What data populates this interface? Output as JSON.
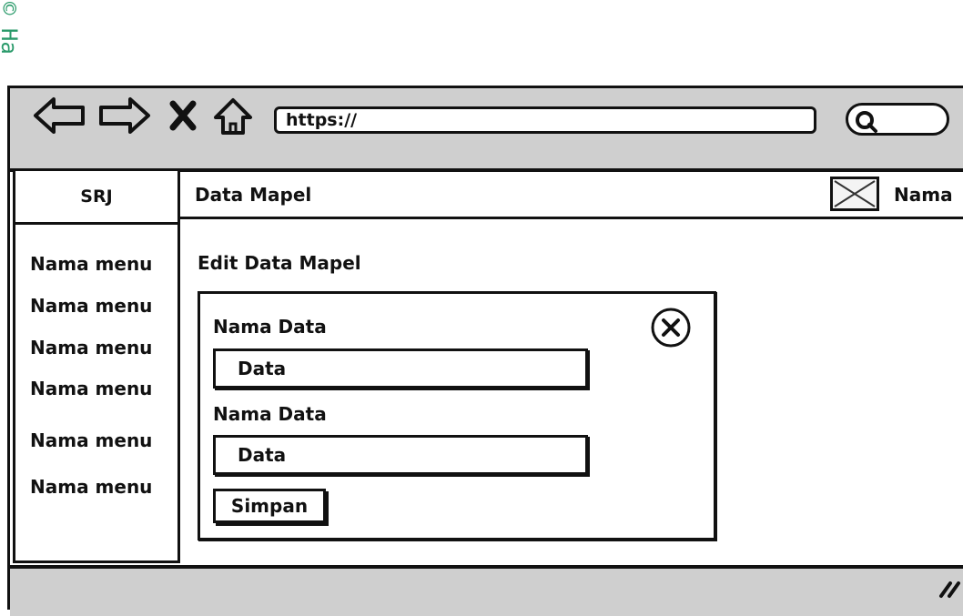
{
  "watermark": "© Ha",
  "browser": {
    "url": "https://",
    "nav": [
      "back-icon",
      "forward-icon",
      "stop-icon",
      "home-icon"
    ],
    "search_icon": "search-icon"
  },
  "sidebar": {
    "brand": "SRJ",
    "items": [
      {
        "label": "Nama menu"
      },
      {
        "label": "Nama menu"
      },
      {
        "label": "Nama menu"
      },
      {
        "label": "Nama menu"
      },
      {
        "label": "Nama menu"
      },
      {
        "label": "Nama menu"
      }
    ]
  },
  "header": {
    "title": "Data Mapel",
    "avatar_icon": "image-placeholder-icon",
    "user_name": "Nama"
  },
  "main": {
    "title": "Edit Data Mapel",
    "modal": {
      "fields": [
        {
          "label": "Nama Data",
          "value": "Data"
        },
        {
          "label": "Nama Data",
          "value": "Data"
        }
      ],
      "submit_label": "Simpan",
      "close_icon": "close-circle-icon"
    }
  },
  "colors": {
    "chrome": "#cfcfcf",
    "ink": "#111111",
    "watermark": "#2a9a6a"
  }
}
